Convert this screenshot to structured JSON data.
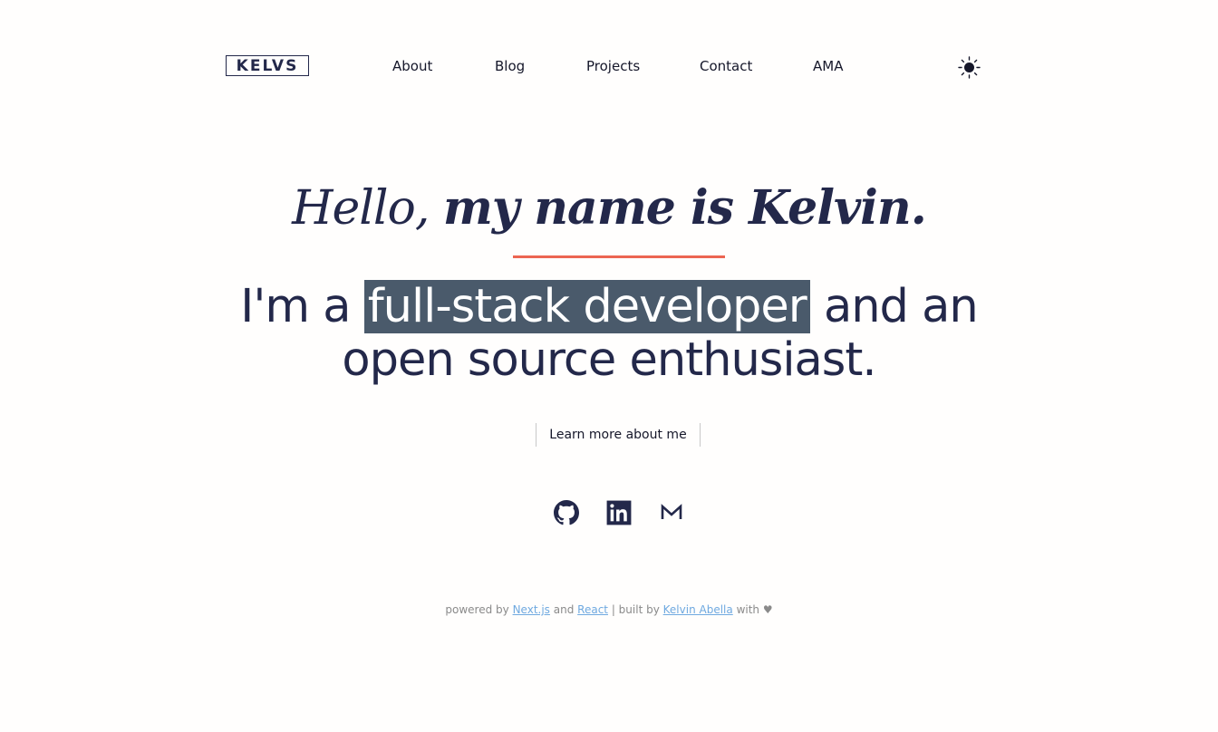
{
  "header": {
    "logo": "KELVS",
    "nav": [
      {
        "label": "About"
      },
      {
        "label": "Blog"
      },
      {
        "label": "Projects"
      },
      {
        "label": "Contact"
      },
      {
        "label": "AMA"
      }
    ],
    "theme_icon": "sun-icon"
  },
  "hero": {
    "greeting_light": "Hello, ",
    "greeting_bold": "my name is Kelvin.",
    "tagline_pre": "I'm a ",
    "tagline_highlight": "full-stack developer",
    "tagline_post": " and an",
    "tagline_line2": "open source enthusiast.",
    "learn_more": "Learn more about me"
  },
  "socials": [
    {
      "icon": "github-icon"
    },
    {
      "icon": "linkedin-icon"
    },
    {
      "icon": "gmail-icon"
    }
  ],
  "footer": {
    "powered_by": "powered by",
    "nextjs": "Next.js",
    "and": "and",
    "react": "React",
    "built_by": "| built by",
    "author": "Kelvin Abella",
    "with": "with",
    "heart": "♥"
  },
  "colors": {
    "text": "#23284a",
    "accent_underline": "#ec6552",
    "highlight_bg": "#4a5a6b",
    "link": "#6fa9e0"
  }
}
